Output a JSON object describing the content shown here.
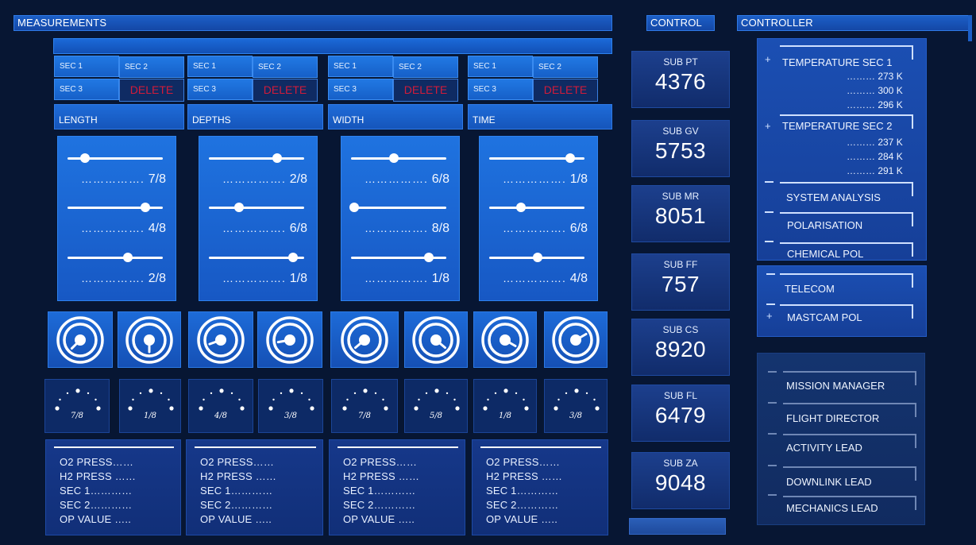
{
  "headers": {
    "measurements": "MEASUREMENTS",
    "control": "CONTROL",
    "controller": "CONTROLLER"
  },
  "sections": [
    {
      "sec1": "SEC 1",
      "sec2": "SEC 2",
      "sec3": "SEC 3",
      "delete": "DELETE",
      "category": "LENGTH"
    },
    {
      "sec1": "SEC 1",
      "sec2": "SEC 2",
      "sec3": "SEC 3",
      "delete": "DELETE",
      "category": "DEPTHS"
    },
    {
      "sec1": "SEC 1",
      "sec2": "SEC 2",
      "sec3": "SEC 3",
      "delete": "DELETE",
      "category": "WIDTH"
    },
    {
      "sec1": "SEC 1",
      "sec2": "SEC 2",
      "sec3": "SEC 3",
      "delete": "DELETE",
      "category": "TIME"
    }
  ],
  "sliders": [
    {
      "levels": [
        0.18,
        0.82,
        0.63
      ],
      "labels": [
        "7/8",
        "4/8",
        "2/8"
      ]
    },
    {
      "levels": [
        0.72,
        0.32,
        0.88
      ],
      "labels": [
        "2/8",
        "6/8",
        "1/8"
      ]
    },
    {
      "levels": [
        0.45,
        0.03,
        0.82
      ],
      "labels": [
        "6/8",
        "8/8",
        "1/8"
      ]
    },
    {
      "levels": [
        0.85,
        0.33,
        0.51
      ],
      "labels": [
        "1/8",
        "6/8",
        "4/8"
      ]
    }
  ],
  "dials": [
    {
      "angle": 225
    },
    {
      "angle": 270
    },
    {
      "angle": 200
    },
    {
      "angle": 190
    },
    {
      "angle": 220
    },
    {
      "angle": 320
    },
    {
      "angle": 330
    },
    {
      "angle": 30
    }
  ],
  "gauges": [
    "7/8",
    "1/8",
    "4/8",
    "3/8",
    "7/8",
    "5/8",
    "1/8",
    "3/8"
  ],
  "readouts": [
    [
      "O2 PRESS……",
      "H2 PRESS ……",
      "SEC 1…………",
      "SEC 2…………",
      "OP VALUE ….."
    ],
    [
      "O2 PRESS……",
      "H2 PRESS ……",
      "SEC 1…………",
      "SEC 2…………",
      "OP VALUE ….."
    ],
    [
      "O2 PRESS……",
      "H2 PRESS ……",
      "SEC 1…………",
      "SEC 2…………",
      "OP VALUE ….."
    ],
    [
      "O2 PRESS……",
      "H2 PRESS ……",
      "SEC 1…………",
      "SEC 2…………",
      "OP VALUE ….."
    ]
  ],
  "control": [
    {
      "label": "SUB PT",
      "value": "4376"
    },
    {
      "label": "SUB GV",
      "value": "5753"
    },
    {
      "label": "SUB MR",
      "value": "8051"
    },
    {
      "label": "SUB FF",
      "value": "757"
    },
    {
      "label": "SUB CS",
      "value": "8920"
    },
    {
      "label": "SUB FL",
      "value": "6479"
    },
    {
      "label": "SUB ZA",
      "value": "9048"
    }
  ],
  "controller": {
    "temp1": {
      "title": "TEMPERATURE SEC 1",
      "values": [
        "……… 273 K",
        "……… 300 K",
        "……… 296 K"
      ]
    },
    "temp2": {
      "title": "TEMPERATURE SEC 2",
      "values": [
        "……… 237 K",
        "……… 284 K",
        "……… 291 K"
      ]
    },
    "items": [
      "SYSTEM ANALYSIS",
      "POLARISATION",
      "CHEMICAL POL"
    ],
    "items2": [
      "TELECOM",
      "MASTCAM POL"
    ],
    "team": [
      "MISSION MANAGER",
      "FLIGHT DIRECTOR",
      "ACTIVITY LEAD",
      "DOWNLINK LEAD",
      "MECHANICS LEAD"
    ],
    "plus": "+"
  }
}
